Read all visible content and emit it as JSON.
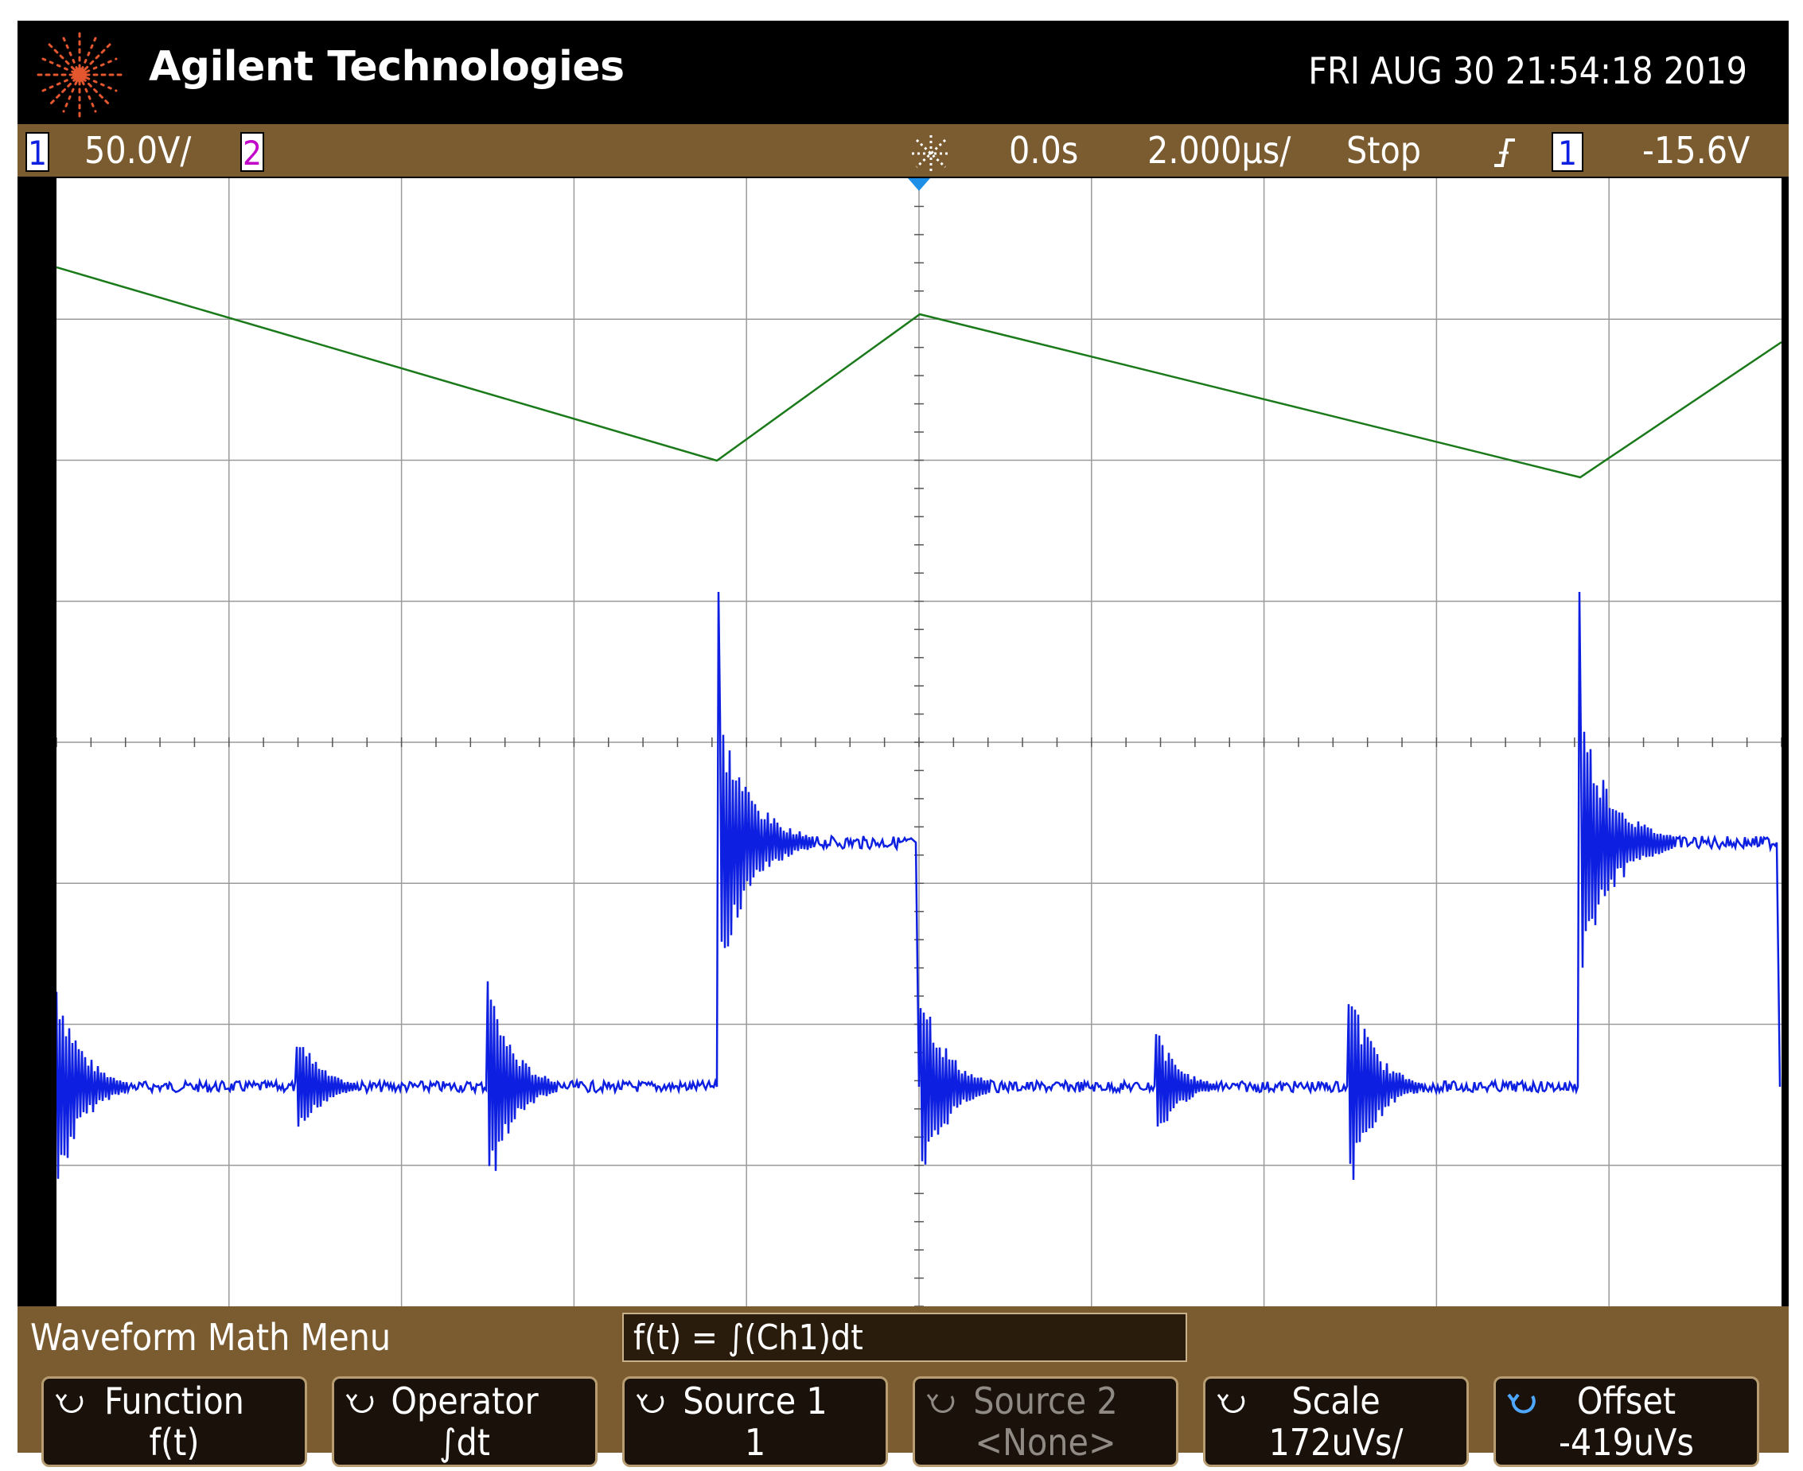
{
  "header": {
    "brand": "Agilent Technologies",
    "datetime": "FRI AUG 30 21:54:18 2019"
  },
  "status": {
    "ch1_number": "1",
    "ch1_scale": "50.0V/",
    "ch2_number": "2",
    "trigger_icon": "trigger-sparkle-icon",
    "time_delay": "0.0s",
    "time_scale": "2.000µs/",
    "run_state": "Stop",
    "trigger_edge_icon": "rising-edge-icon",
    "trigger_source": "1",
    "trigger_level": "-15.6V"
  },
  "display": {
    "ch1_marker": "1",
    "colors": {
      "ch1": "#0d1fe0",
      "math": "#1a7a1a",
      "grid": "#9a9a9a",
      "bezel": "#7a5c30"
    }
  },
  "menu": {
    "title": "Waveform Math Menu",
    "formula": "f(t) = ∫(Ch1)dt",
    "softkeys": [
      {
        "label": "Function",
        "value": "f(t)"
      },
      {
        "label": "Operator",
        "value": "∫dt"
      },
      {
        "label": "Source 1",
        "value": "1"
      },
      {
        "label": "Source 2",
        "value": "<None>"
      },
      {
        "label": "Scale",
        "value": "172uVs/"
      },
      {
        "label": "Offset",
        "value": "-419uVs"
      }
    ]
  }
}
